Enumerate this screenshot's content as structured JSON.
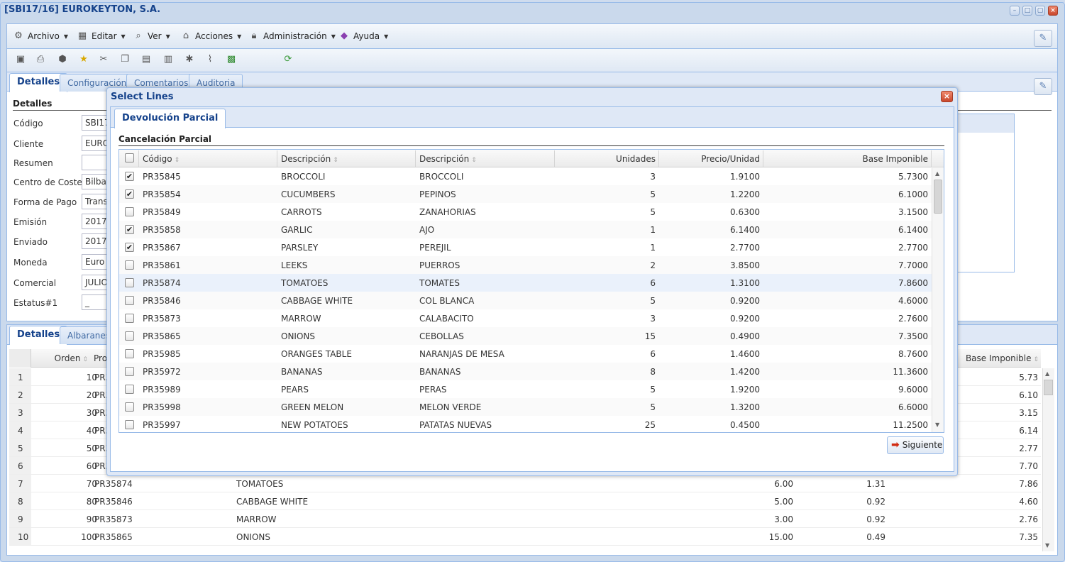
{
  "window": {
    "title": "[SBI17/16] EUROKEYTON, S.A.",
    "controls": [
      "–",
      "□",
      "▢",
      "×"
    ]
  },
  "menu": [
    {
      "label": "Archivo",
      "icon": "gear-icon"
    },
    {
      "label": "Editar",
      "icon": "edit-icon"
    },
    {
      "label": "Ver",
      "icon": "view-icon"
    },
    {
      "label": "Acciones",
      "icon": "actions-icon"
    },
    {
      "label": "Administración",
      "icon": "lock-icon"
    },
    {
      "label": "Ayuda",
      "icon": "help-book-icon"
    }
  ],
  "toolbar_icons": [
    "save-icon",
    "print-icon",
    "delete-icon",
    "favorite-star-icon",
    "cut-icon",
    "copy-icon",
    "paste-icon",
    "report-icon",
    "export-icon",
    "attach-icon",
    "excel-icon",
    "refresh-icon"
  ],
  "top_tabs": [
    "Detalles",
    "Configuración",
    "Comentarios",
    "Auditoria"
  ],
  "details": {
    "heading": "Detalles",
    "fields": [
      {
        "label": "Código",
        "value": "SBI17"
      },
      {
        "label": "Cliente",
        "value": "EURO"
      },
      {
        "label": "Resumen",
        "value": ""
      },
      {
        "label": "Centro de Coste",
        "value": "Bilbao"
      },
      {
        "label": "Forma de Pago",
        "value": "Trans"
      },
      {
        "label": "Emisión",
        "value": "2017-0"
      },
      {
        "label": "Enviado",
        "value": "2017-0"
      },
      {
        "label": "Moneda",
        "value": "Euro"
      },
      {
        "label": "Comercial",
        "value": "JULIO"
      },
      {
        "label": "Estatus#1",
        "value": "_"
      }
    ]
  },
  "lower_tabs": [
    "Detalles",
    "Albaranes"
  ],
  "lower_grid": {
    "headers": {
      "orden": "Orden",
      "producto": "Pro",
      "base": "Base Imponible"
    },
    "rows": [
      {
        "n": "1",
        "orden": "10",
        "prod": "PR3",
        "desc": "",
        "uds": "",
        "precio": "",
        "base": "5.73"
      },
      {
        "n": "2",
        "orden": "20",
        "prod": "PR3",
        "desc": "",
        "uds": "",
        "precio": "",
        "base": "6.10"
      },
      {
        "n": "3",
        "orden": "30",
        "prod": "PR3",
        "desc": "",
        "uds": "",
        "precio": "",
        "base": "3.15"
      },
      {
        "n": "4",
        "orden": "40",
        "prod": "PR3",
        "desc": "",
        "uds": "",
        "precio": "",
        "base": "6.14"
      },
      {
        "n": "5",
        "orden": "50",
        "prod": "PR3",
        "desc": "",
        "uds": "",
        "precio": "",
        "base": "2.77"
      },
      {
        "n": "6",
        "orden": "60",
        "prod": "PR3",
        "desc": "",
        "uds": "",
        "precio": "",
        "base": "7.70"
      },
      {
        "n": "7",
        "orden": "70",
        "prod": "PR35874",
        "desc": "TOMATOES",
        "uds": "6.00",
        "precio": "1.31",
        "base": "7.86"
      },
      {
        "n": "8",
        "orden": "80",
        "prod": "PR35846",
        "desc": "CABBAGE WHITE",
        "uds": "5.00",
        "precio": "0.92",
        "base": "4.60"
      },
      {
        "n": "9",
        "orden": "90",
        "prod": "PR35873",
        "desc": "MARROW",
        "uds": "3.00",
        "precio": "0.92",
        "base": "2.76"
      },
      {
        "n": "10",
        "orden": "100",
        "prod": "PR35865",
        "desc": "ONIONS",
        "uds": "15.00",
        "precio": "0.49",
        "base": "7.35"
      }
    ]
  },
  "dialog": {
    "title": "Select Lines",
    "tab": "Devolución Parcial",
    "section": "Cancelación Parcial",
    "headers": {
      "codigo": "Código",
      "desc1": "Descripción",
      "desc2": "Descripción",
      "unidades": "Unidades",
      "precio": "Precio/Unidad",
      "base": "Base Imponible"
    },
    "rows": [
      {
        "checked": true,
        "codigo": "PR35845",
        "desc1": "BROCCOLI",
        "desc2": "BROCCOLI",
        "unidades": "3",
        "precio": "1.9100",
        "base": "5.7300"
      },
      {
        "checked": true,
        "codigo": "PR35854",
        "desc1": "CUCUMBERS",
        "desc2": "PEPINOS",
        "unidades": "5",
        "precio": "1.2200",
        "base": "6.1000"
      },
      {
        "checked": false,
        "codigo": "PR35849",
        "desc1": "CARROTS",
        "desc2": "ZANAHORIAS",
        "unidades": "5",
        "precio": "0.6300",
        "base": "3.1500"
      },
      {
        "checked": true,
        "codigo": "PR35858",
        "desc1": "GARLIC",
        "desc2": "AJO",
        "unidades": "1",
        "precio": "6.1400",
        "base": "6.1400"
      },
      {
        "checked": true,
        "codigo": "PR35867",
        "desc1": "PARSLEY",
        "desc2": "PEREJIL",
        "unidades": "1",
        "precio": "2.7700",
        "base": "2.7700"
      },
      {
        "checked": false,
        "codigo": "PR35861",
        "desc1": "LEEKS",
        "desc2": "PUERROS",
        "unidades": "2",
        "precio": "3.8500",
        "base": "7.7000"
      },
      {
        "checked": false,
        "codigo": "PR35874",
        "desc1": "TOMATOES",
        "desc2": "TOMATES",
        "unidades": "6",
        "precio": "1.3100",
        "base": "7.8600"
      },
      {
        "checked": false,
        "codigo": "PR35846",
        "desc1": "CABBAGE WHITE",
        "desc2": "COL BLANCA",
        "unidades": "5",
        "precio": "0.9200",
        "base": "4.6000"
      },
      {
        "checked": false,
        "codigo": "PR35873",
        "desc1": "MARROW",
        "desc2": "CALABACITO",
        "unidades": "3",
        "precio": "0.9200",
        "base": "2.7600"
      },
      {
        "checked": false,
        "codigo": "PR35865",
        "desc1": "ONIONS",
        "desc2": "CEBOLLAS",
        "unidades": "15",
        "precio": "0.4900",
        "base": "7.3500"
      },
      {
        "checked": false,
        "codigo": "PR35985",
        "desc1": "ORANGES TABLE",
        "desc2": "NARANJAS DE MESA",
        "unidades": "6",
        "precio": "1.4600",
        "base": "8.7600"
      },
      {
        "checked": false,
        "codigo": "PR35972",
        "desc1": "BANANAS",
        "desc2": "BANANAS",
        "unidades": "8",
        "precio": "1.4200",
        "base": "11.3600"
      },
      {
        "checked": false,
        "codigo": "PR35989",
        "desc1": "PEARS",
        "desc2": "PERAS",
        "unidades": "5",
        "precio": "1.9200",
        "base": "9.6000"
      },
      {
        "checked": false,
        "codigo": "PR35998",
        "desc1": "GREEN MELON",
        "desc2": "MELON VERDE",
        "unidades": "5",
        "precio": "1.3200",
        "base": "6.6000"
      },
      {
        "checked": false,
        "codigo": "PR35997",
        "desc1": "NEW POTATOES",
        "desc2": "PATATAS NUEVAS",
        "unidades": "25",
        "precio": "0.4500",
        "base": "11.2500"
      }
    ],
    "next_label": "Siguiente"
  },
  "colors": {
    "accent": "#15428b",
    "border": "#99bbe8",
    "highlight_row": "#eaf1fb"
  }
}
